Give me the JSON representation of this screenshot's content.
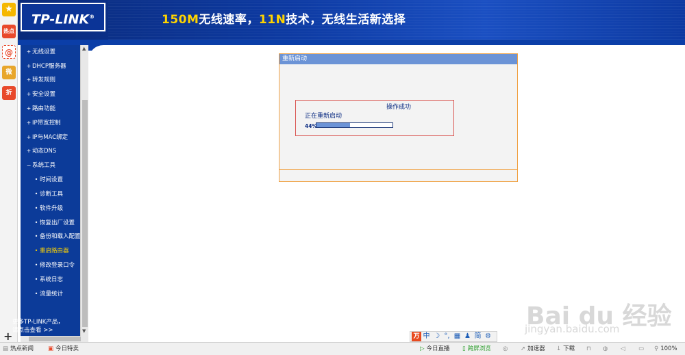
{
  "banner": {
    "logo": "TP-LINK",
    "logo_mark": "®",
    "slogan_a": "150M",
    "slogan_b": "无线速率，",
    "slogan_c": "11N",
    "slogan_d": "技术，无线生活新选择"
  },
  "left_strip": [
    {
      "name": "favorites",
      "label": "★",
      "color": "#f5b700"
    },
    {
      "name": "hot",
      "label": "热点",
      "color": "#e8492b"
    },
    {
      "name": "mail",
      "label": "@",
      "color": "#e8492b"
    },
    {
      "name": "weibo",
      "label": "微",
      "color": "#e8a62b"
    },
    {
      "name": "discount",
      "label": "折",
      "color": "#e8492b"
    }
  ],
  "nav": {
    "items": [
      {
        "label": "无线设置",
        "type": "top"
      },
      {
        "label": "DHCP服务器",
        "type": "top"
      },
      {
        "label": "转发规则",
        "type": "top"
      },
      {
        "label": "安全设置",
        "type": "top"
      },
      {
        "label": "路由功能",
        "type": "top"
      },
      {
        "label": "IP带宽控制",
        "type": "top"
      },
      {
        "label": "IP与MAC绑定",
        "type": "top"
      },
      {
        "label": "动态DNS",
        "type": "top"
      },
      {
        "label": "系统工具",
        "type": "top-open"
      },
      {
        "label": "时间设置",
        "type": "sub"
      },
      {
        "label": "诊断工具",
        "type": "sub"
      },
      {
        "label": "软件升级",
        "type": "sub"
      },
      {
        "label": "恢复出厂设置",
        "type": "sub"
      },
      {
        "label": "备份和载入配置",
        "type": "sub"
      },
      {
        "label": "重启路由器",
        "type": "sub-active"
      },
      {
        "label": "修改登录口令",
        "type": "sub"
      },
      {
        "label": "系统日志",
        "type": "sub"
      },
      {
        "label": "流量统计",
        "type": "sub"
      }
    ],
    "more_line1": "更多TP-LINK产品，",
    "more_line2": "请点击查看 >>"
  },
  "panel": {
    "title": "重新启动",
    "box_title": "操作成功",
    "status": "正在重新启动",
    "progress_label": "44%",
    "progress": 0.44
  },
  "ime": {
    "logo": "万",
    "items": [
      "中",
      "☽",
      "°,",
      "▦",
      "♟",
      "简",
      "⚙"
    ]
  },
  "watermark": {
    "main": "Bai du 经验",
    "sub": "jingyan.baidu.com"
  },
  "status_bar": {
    "hot_news": "热点新闻",
    "today_deals": "今日特卖",
    "live": "今日直播",
    "cross_screen": "跨屏浏览",
    "accelerator": "加速器",
    "download": "下载",
    "zoom": "100%"
  },
  "colors": {
    "nav_bg": "#0c3b99",
    "panel_head": "#6b93d6",
    "panel_border": "#f0a040",
    "box_border": "#d9534f",
    "active_item": "#ffd400"
  }
}
